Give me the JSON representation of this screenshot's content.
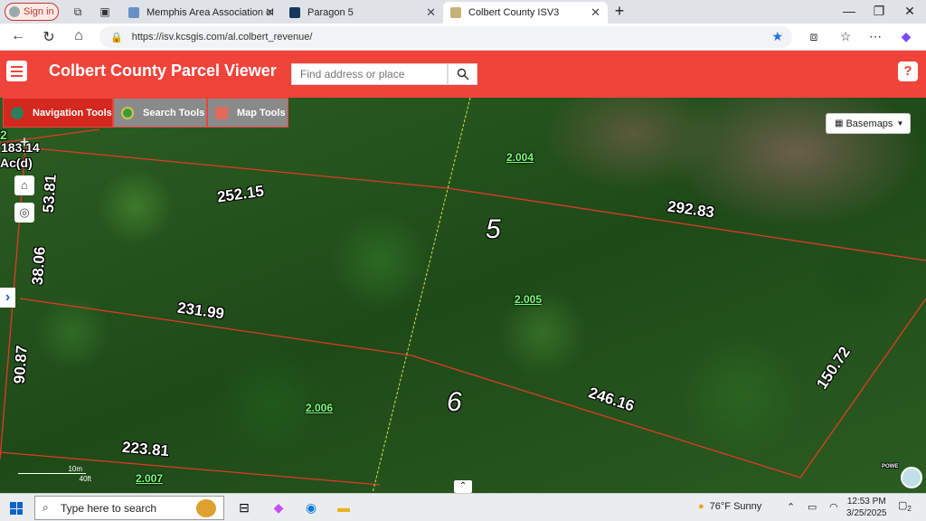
{
  "browser": {
    "signin_label": "Sign in",
    "tabs": [
      {
        "label": "Memphis Area Association of REA",
        "active": false
      },
      {
        "label": "Paragon 5",
        "active": false
      },
      {
        "label": "Colbert County ISV3",
        "active": true
      }
    ],
    "url": "https://isv.kcsgis.com/al.colbert_revenue/"
  },
  "app": {
    "title": "Colbert County Parcel Viewer",
    "search_placeholder": "Find address or place",
    "help_label": "?",
    "tool_tabs": [
      {
        "label": "Navigation Tools",
        "active": true
      },
      {
        "label": "Search Tools",
        "active": false
      },
      {
        "label": "Map Tools",
        "active": false
      }
    ],
    "basemaps_label": "Basemaps"
  },
  "map": {
    "corner_label_top": "2",
    "corner_label_area": "183.14",
    "corner_label_unit": "Ac(d)",
    "dimensions": [
      "252.15",
      "292.83",
      "53.81",
      "38.06",
      "231.99",
      "90.87",
      "246.16",
      "150.72",
      "223.81"
    ],
    "lots": [
      "5",
      "6"
    ],
    "parcels": [
      "2.004",
      "2.005",
      "2.006",
      "2.007"
    ],
    "scale": {
      "metric": "10m",
      "imperial": "40ft"
    },
    "powered_label": "POWE"
  },
  "taskbar": {
    "search_placeholder": "Type here to search",
    "weather": "76°F  Sunny",
    "time": "12:53 PM",
    "date": "3/25/2025",
    "notification_count": "2"
  },
  "colors": {
    "accent": "#f0433a",
    "parcel_line": "#e03a2a",
    "parcel_label": "#7CFC7C"
  }
}
